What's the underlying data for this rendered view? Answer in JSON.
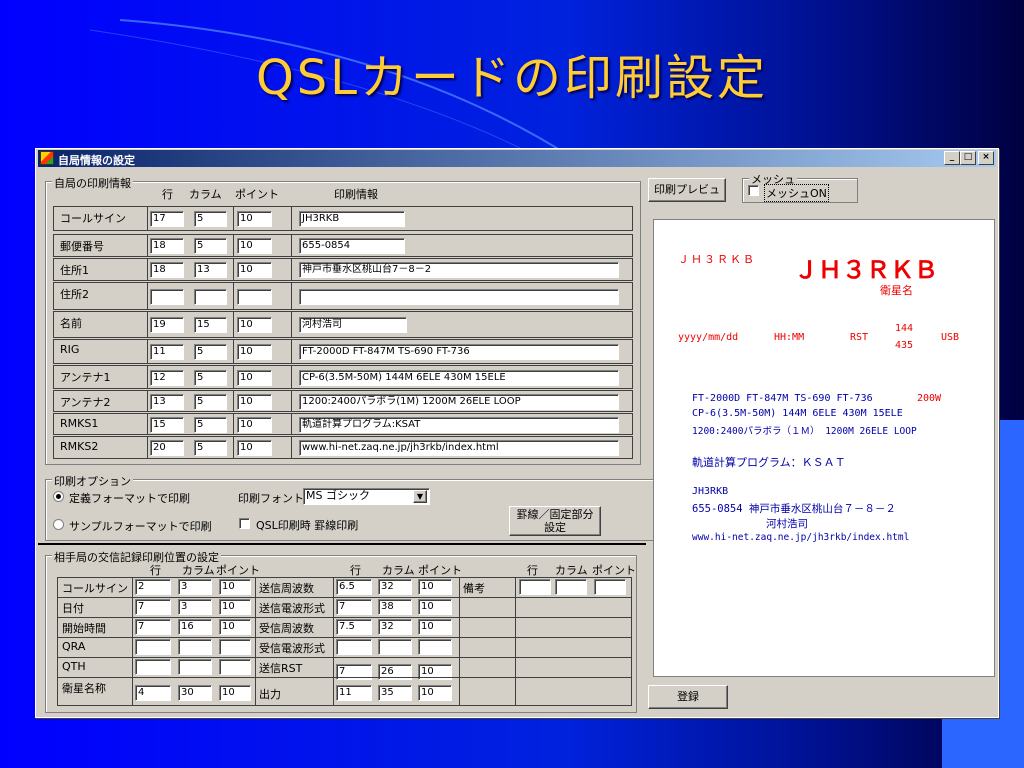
{
  "slide": {
    "title": "QSLカードの印刷設定"
  },
  "window": {
    "title": "自局情報の設定",
    "min": "_",
    "max": "□",
    "close": "×"
  },
  "own": {
    "legend": "自局の印刷情報",
    "headers": {
      "row": "行",
      "col": "カラム",
      "point": "ポイント",
      "info": "印刷情報"
    },
    "rows": [
      {
        "label": "コールサイン",
        "row": "17",
        "col": "5",
        "pt": "10",
        "info": "JH3RKB"
      },
      {
        "label": "郵便番号",
        "row": "18",
        "col": "5",
        "pt": "10",
        "info": "655-0854"
      },
      {
        "label": "住所1",
        "row": "18",
        "col": "13",
        "pt": "10",
        "info": "神戸市垂水区桃山台7－8－2"
      },
      {
        "label": "住所2",
        "row": "",
        "col": "",
        "pt": "",
        "info": ""
      },
      {
        "label": "名前",
        "row": "19",
        "col": "15",
        "pt": "10",
        "info": "河村浩司"
      },
      {
        "label": "RIG",
        "row": "11",
        "col": "5",
        "pt": "10",
        "info": "FT-2000D FT-847M TS-690 FT-736"
      },
      {
        "label": "アンテナ1",
        "row": "12",
        "col": "5",
        "pt": "10",
        "info": "CP-6(3.5M-50M) 144M 6ELE 430M 15ELE"
      },
      {
        "label": "アンテナ2",
        "row": "13",
        "col": "5",
        "pt": "10",
        "info": "1200:2400パラボラ(1M)  1200M  26ELE LOOP"
      },
      {
        "label": "RMKS1",
        "row": "15",
        "col": "5",
        "pt": "10",
        "info": "軌道計算プログラム:KSAT"
      },
      {
        "label": "RMKS2",
        "row": "20",
        "col": "5",
        "pt": "10",
        "info": "www.hi-net.zaq.ne.jp/jh3rkb/index.html"
      }
    ]
  },
  "options": {
    "legend": "印刷オプション",
    "radio1": "定義フォーマットで印刷",
    "radio2": "サンプルフォーマットで印刷",
    "font_label": "印刷フォント",
    "font_value": "MS ゴシック",
    "qsl_check": "QSL印刷時  罫線印刷",
    "ruled_btn_1": "罫線／固定部分",
    "ruled_btn_2": "設定"
  },
  "partner": {
    "legend": "相手局の交信記録印刷位置の設定",
    "headers": {
      "row": "行",
      "col": "カラム",
      "point": "ポイント"
    },
    "left": [
      {
        "label": "コールサイン",
        "row": "2",
        "col": "3",
        "pt": "10"
      },
      {
        "label": "日付",
        "row": "7",
        "col": "3",
        "pt": "10"
      },
      {
        "label": "開始時間",
        "row": "7",
        "col": "16",
        "pt": "10"
      },
      {
        "label": "QRA",
        "row": "",
        "col": "",
        "pt": ""
      },
      {
        "label": "QTH",
        "row": "",
        "col": "",
        "pt": ""
      },
      {
        "label": "衛星名称",
        "row": "4",
        "col": "30",
        "pt": "10"
      }
    ],
    "mid": [
      {
        "label": "送信周波数",
        "row": "6.5",
        "col": "32",
        "pt": "10"
      },
      {
        "label": "送信電波形式",
        "row": "7",
        "col": "38",
        "pt": "10"
      },
      {
        "label": "受信周波数",
        "row": "7.5",
        "col": "32",
        "pt": "10"
      },
      {
        "label": "受信電波形式",
        "row": "",
        "col": "",
        "pt": ""
      },
      {
        "label": "送信RST",
        "row": "7",
        "col": "26",
        "pt": "10"
      },
      {
        "label": "出力",
        "row": "11",
        "col": "35",
        "pt": "10"
      }
    ],
    "remarks_label": "備考"
  },
  "right": {
    "preview_btn": "印刷プレビュ",
    "mesh_legend": "メッシュ",
    "mesh_check": "メッシュON",
    "register_btn": "登録"
  },
  "preview": {
    "small_call": "ＪＨ３ＲＫＢ",
    "big_call": "ＪＨ３ＲＫＢ",
    "sat": "衛星名",
    "date": "yyyy/mm/dd",
    "time": "HH:MM",
    "rst": "RST",
    "f1": "144",
    "f2": "435",
    "mode": "USB",
    "rig": "FT-2000D FT-847M TS-690 FT-736",
    "power": "200W",
    "ant1": "CP-6(3.5M-50M) 144M 6ELE 430M 15ELE",
    "ant2": "1200:2400パラボラ（１Ｍ）  1200M  26ELE LOOP",
    "rmks": "軌道計算プログラム：ＫＳＡＴ",
    "call": "JH3RKB",
    "addr": "655-0854 神戸市垂水区桃山台７－８－２",
    "name": "河村浩司",
    "url": "www.hi-net.zaq.ne.jp/jh3rkb/index.html"
  }
}
